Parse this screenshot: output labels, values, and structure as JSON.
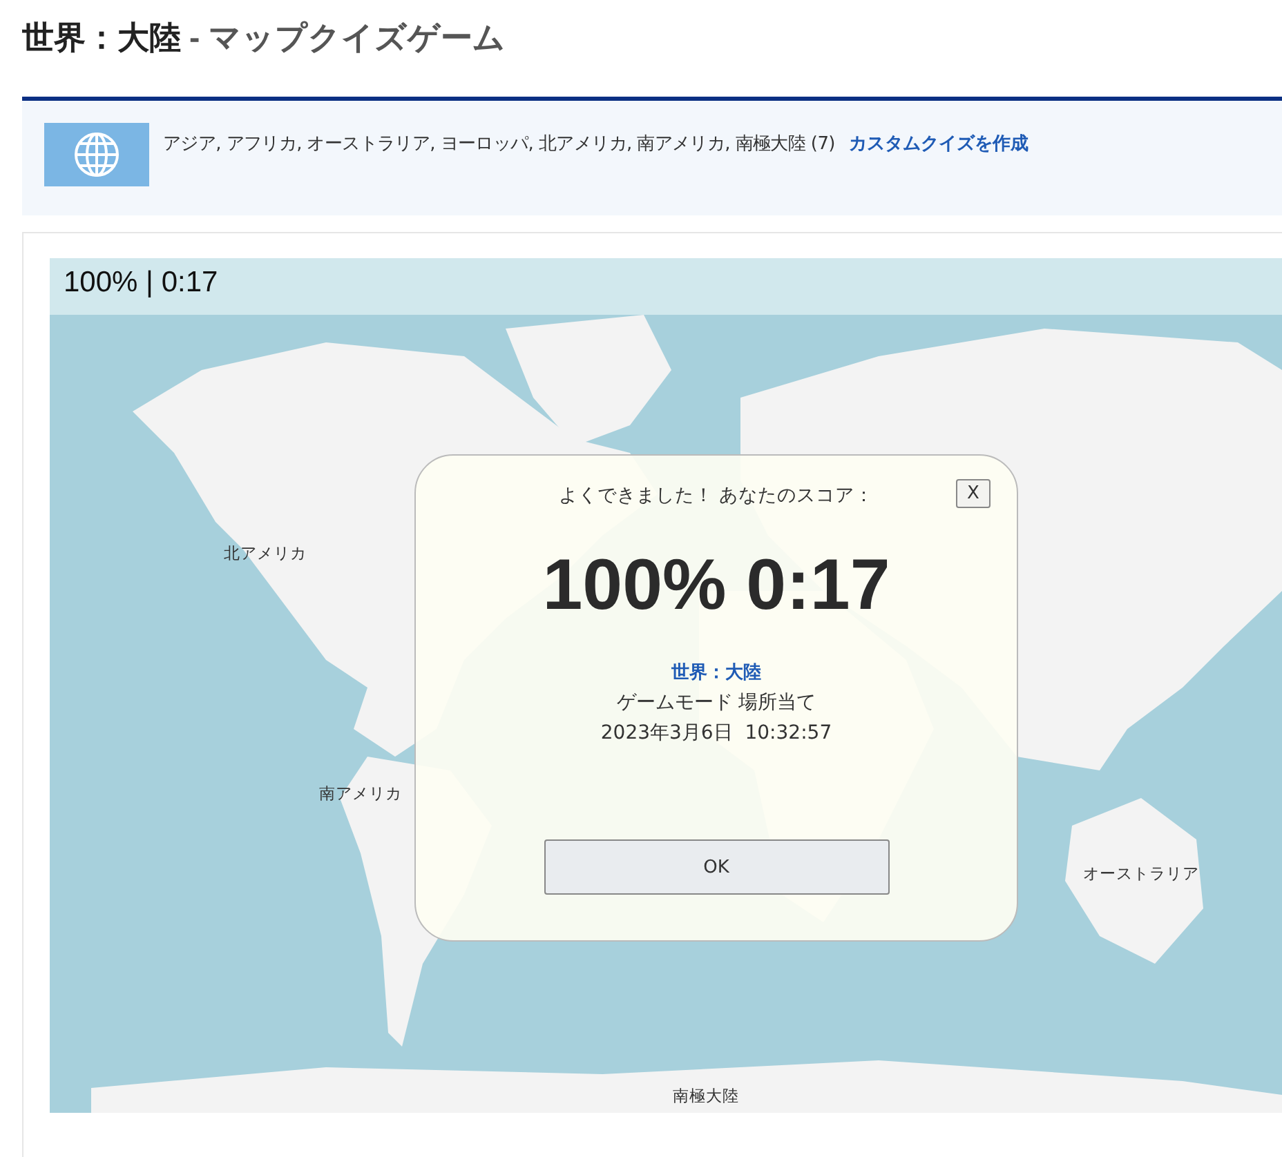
{
  "page_title": {
    "main": "世界：大陸",
    "sub": "- マップクイズゲーム"
  },
  "info": {
    "description": "アジア, アフリカ, オーストラリア, ヨーロッパ, 北アメリカ, 南アメリカ, 南極大陸 (7)",
    "link": "カスタムクイズを作成"
  },
  "status_bar": "100% | 0:17",
  "map_labels": [
    "北アメリカ",
    "南アメリカ",
    "オーストラリア",
    "南極大陸"
  ],
  "dialog": {
    "heading": "よくできました！ あなたのスコア：",
    "close": "X",
    "score": "100% 0:17",
    "quiz_name": "世界：大陸",
    "mode": "ゲームモード 場所当て",
    "date": "2023年3月6日  10:32:57",
    "ok": "OK"
  }
}
